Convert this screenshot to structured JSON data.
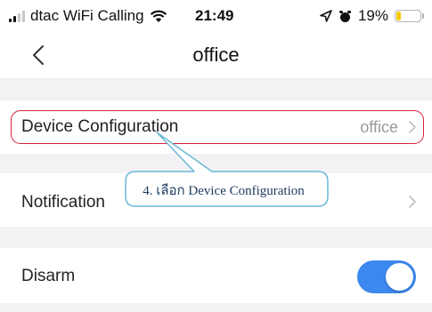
{
  "status_bar": {
    "carrier": "dtac WiFi Calling",
    "time": "21:49",
    "battery": "19%",
    "battery_level": 0.19,
    "battery_color": "#f7c600",
    "icons": [
      "signal-icon",
      "wifi-icon",
      "location-icon",
      "alarm-icon",
      "battery-icon"
    ]
  },
  "nav": {
    "title": "office",
    "back_icon": "chevron-left-icon"
  },
  "rows": {
    "device_configuration": {
      "label": "Device Configuration",
      "value": "office"
    },
    "notification": {
      "label": "Notification"
    },
    "disarm": {
      "label": "Disarm",
      "toggle_on": true,
      "toggle_color": "#3b88ef"
    }
  },
  "annotation": {
    "callout": "4. เลือก Device Configuration",
    "highlight_color": "#d8213a",
    "callout_color": "#6bb8d6"
  }
}
